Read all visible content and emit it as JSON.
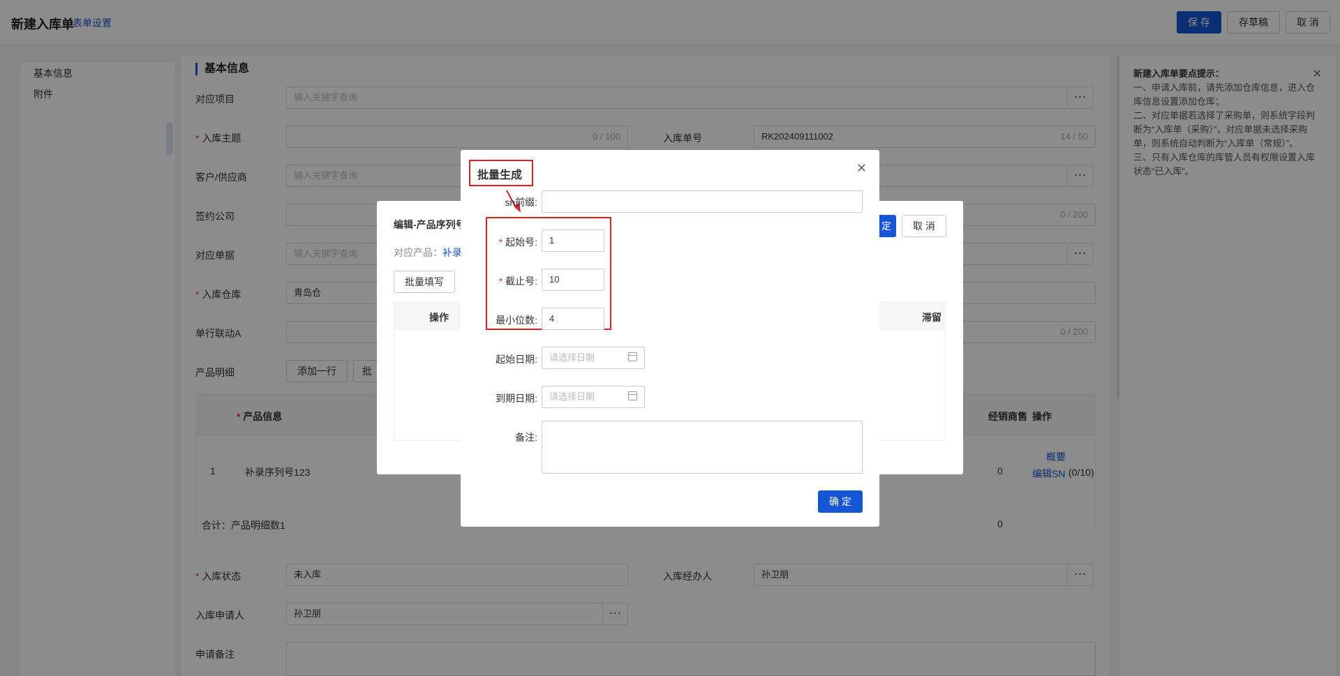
{
  "header": {
    "title": "新建入库单",
    "form_settings": "表单设置",
    "save": "保 存",
    "draft": "存草稿",
    "cancel": "取 消"
  },
  "leftnav": {
    "items": [
      "基本信息",
      "附件"
    ]
  },
  "section": {
    "basic_info": "基本信息"
  },
  "form": {
    "project_label": "对应项目",
    "project_placeholder": "输入关键字查询",
    "subject_label": "入库主题",
    "subject_count": "0 / 100",
    "orderno_label": "入库单号",
    "orderno_value": "RK202409111002",
    "orderno_count": "14 / 50",
    "customer_label": "客户/供应商",
    "customer_placeholder": "输入关键字查询",
    "company_label": "签约公司",
    "company_count": "0 / 200",
    "doc_label": "对应单据",
    "doc_placeholder": "输入关键字查询",
    "warehouse_label": "入库仓库",
    "warehouse_value": "青岛仓",
    "linkage_label": "单行联动A",
    "linkage_count": "0 / 200",
    "detail_label": "产品明细",
    "add_row": "添加一行",
    "batch_partial": "批",
    "status_label": "入库状态",
    "status_value": "未入库",
    "handler_label": "入库经办人",
    "handler_value": "孙卫朋",
    "applicant_label": "入库申请人",
    "applicant_value": "孙卫朋",
    "remark_label": "申请备注"
  },
  "table": {
    "col_product": "产品信息",
    "col_dealer": "经销商售",
    "col_action": "操作",
    "row_index": "1",
    "row_product": "补录序列号123",
    "row_zero": "0",
    "row_summary": "概要",
    "row_edit_sn": "编辑SN",
    "row_edit_count": "(0/10)",
    "total_label": "合计：产品明细数1",
    "total_zero": "0"
  },
  "tips": {
    "title": "新建入库单要点提示：",
    "lines": [
      "一、申请入库前，请先添加仓库信息，进入仓库信息设置添加仓库；",
      "二、对应单据若选择了采购单，则系统字段判断为“入库单（采购）”，对应单据未选择采购单，则系统自动判断为“入库单（常规）”。",
      "三、只有入库仓库的库管人员有权限设置入库状态“已入库”。"
    ]
  },
  "dialog2": {
    "title": "编辑-产品序列号",
    "product_label": "对应产品：",
    "product_value": "补录",
    "batch_fill": "批量填写",
    "col_action": "操作",
    "col_stagnant": "滞留",
    "confirm_partial": "定",
    "cancel": "取 消"
  },
  "dialog": {
    "title": "批量生成",
    "sn_prefix_label": "sn前缀:",
    "start_label": "起始号:",
    "start_value": "1",
    "end_label": "截止号:",
    "end_value": "10",
    "min_digits_label": "最小位数:",
    "min_digits_value": "4",
    "start_date_label": "起始日期:",
    "start_date_placeholder": "请选择日期",
    "end_date_label": "到期日期:",
    "end_date_placeholder": "请选择日期",
    "remark_label": "备注:",
    "confirm": "确 定"
  }
}
